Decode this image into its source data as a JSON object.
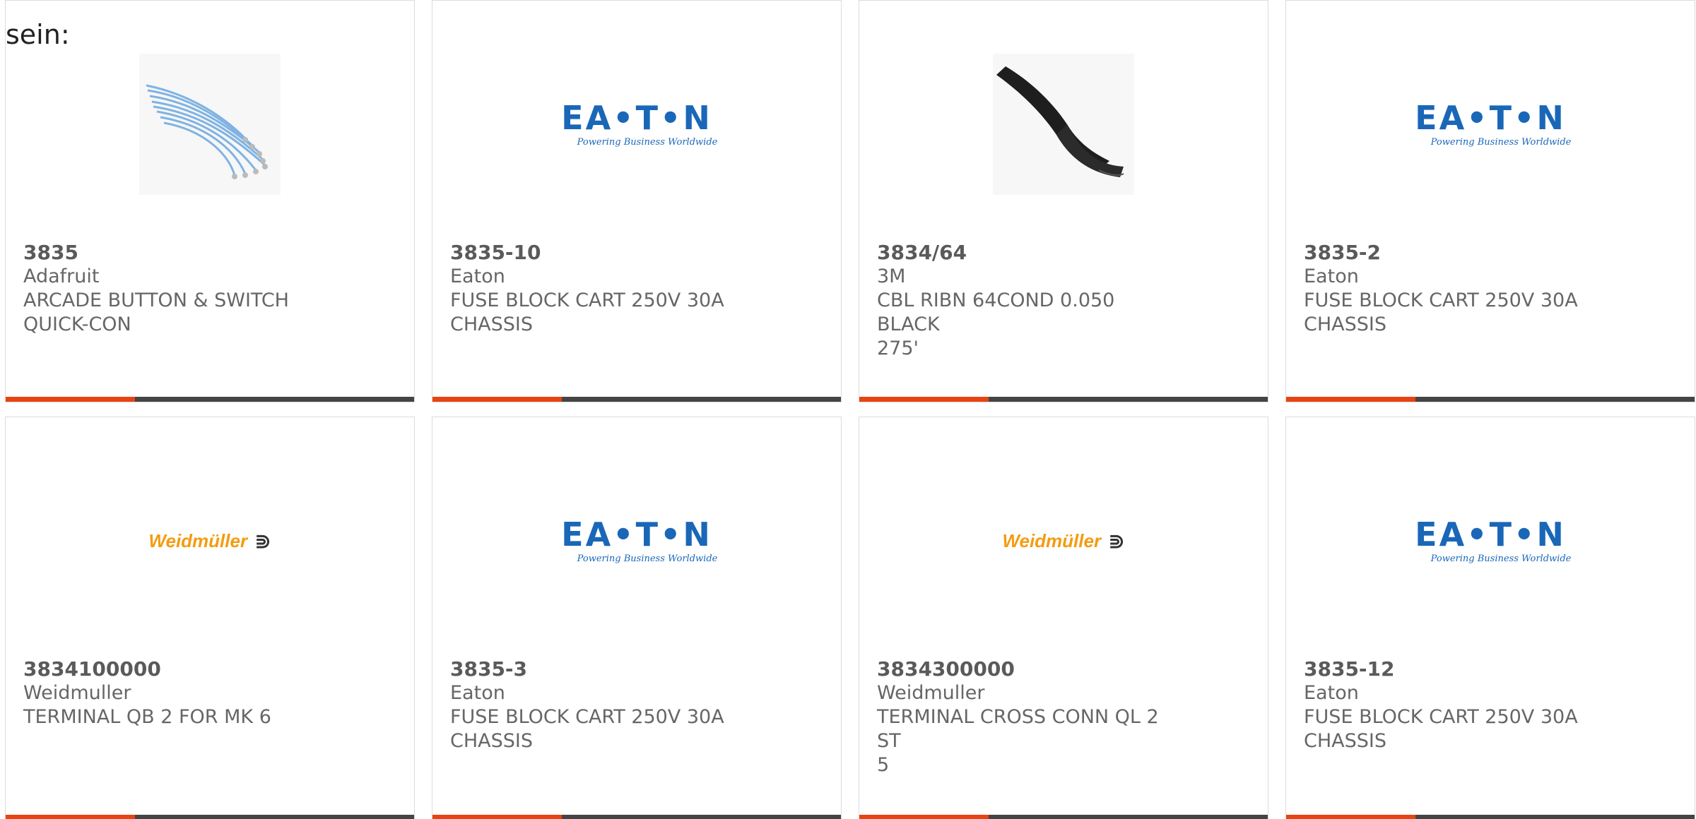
{
  "intro_text": "sein:",
  "products": [
    {
      "part": "3835",
      "maker": "Adafruit",
      "desc_line1": "ARCADE BUTTON & SWITCH",
      "desc_line2": "QUICK-CON",
      "image": "cable-wires-photo"
    },
    {
      "part": "3835-10",
      "maker": "Eaton",
      "desc_line1": "FUSE BLOCK CART 250V 30A",
      "desc_line2": "CHASSIS",
      "image": "eaton-logo"
    },
    {
      "part": "3834/64",
      "maker": "3M",
      "desc_line1": "CBL RIBN 64COND 0.050 BLACK",
      "desc_line2": "275'",
      "image": "ribbon-cable-photo"
    },
    {
      "part": "3835-2",
      "maker": "Eaton",
      "desc_line1": "FUSE BLOCK CART 250V 30A",
      "desc_line2": "CHASSIS",
      "image": "eaton-logo"
    },
    {
      "part": "3834100000",
      "maker": "Weidmuller",
      "desc_line1": "TERMINAL QB 2 FOR MK 6",
      "desc_line2": "",
      "image": "weidmuller-logo"
    },
    {
      "part": "3835-3",
      "maker": "Eaton",
      "desc_line1": "FUSE BLOCK CART 250V 30A",
      "desc_line2": "CHASSIS",
      "image": "eaton-logo"
    },
    {
      "part": "3834300000",
      "maker": "Weidmuller",
      "desc_line1": "TERMINAL CROSS CONN QL 2 ST",
      "desc_line2": "5",
      "image": "weidmuller-logo"
    },
    {
      "part": "3835-12",
      "maker": "Eaton",
      "desc_line1": "FUSE BLOCK CART 250V 30A",
      "desc_line2": "CHASSIS",
      "image": "eaton-logo"
    }
  ],
  "logos": {
    "eaton_word": "EA•T•N",
    "eaton_tagline": "Powering Business Worldwide",
    "weidmuller_word": "Weidmüller",
    "weidmuller_mark": "⋑"
  },
  "colors": {
    "accent": "#e84312",
    "bar_dark": "#444444",
    "eaton_blue": "#1a67b8",
    "weidmuller_orange": "#f39c12",
    "text_gray": "#666666"
  }
}
